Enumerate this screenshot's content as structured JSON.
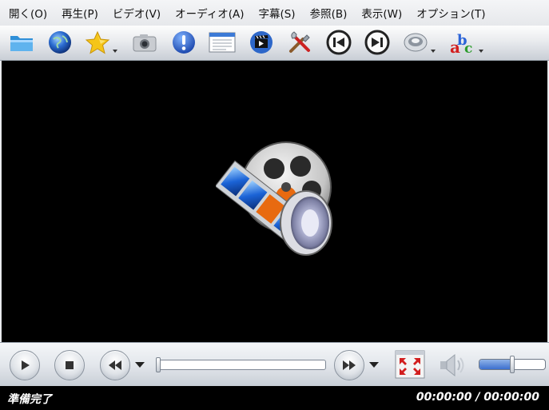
{
  "menu": [
    "開く(O)",
    "再生(P)",
    "ビデオ(V)",
    "オーディオ(A)",
    "字幕(S)",
    "参照(B)",
    "表示(W)",
    "オプション(T)"
  ],
  "toolbar": {
    "icons": [
      "folder-open-icon",
      "globe-icon",
      "favorites-star-icon",
      "screenshot-camera-icon",
      "info-icon",
      "playlist-icon",
      "video-clapper-icon",
      "preferences-tools-icon",
      "previous-icon",
      "next-icon",
      "audio-speaker-icon",
      "subtitles-abc-icon"
    ]
  },
  "controls": {
    "seek_fraction": 0.0,
    "volume_fraction": 0.5
  },
  "status": {
    "message": "準備完了",
    "time": "00:00:00 / 00:00:00"
  },
  "colors": {
    "accent": "#3b6fcf",
    "video_background": "#000000",
    "status_background": "#000000",
    "status_text": "#ffffff"
  }
}
